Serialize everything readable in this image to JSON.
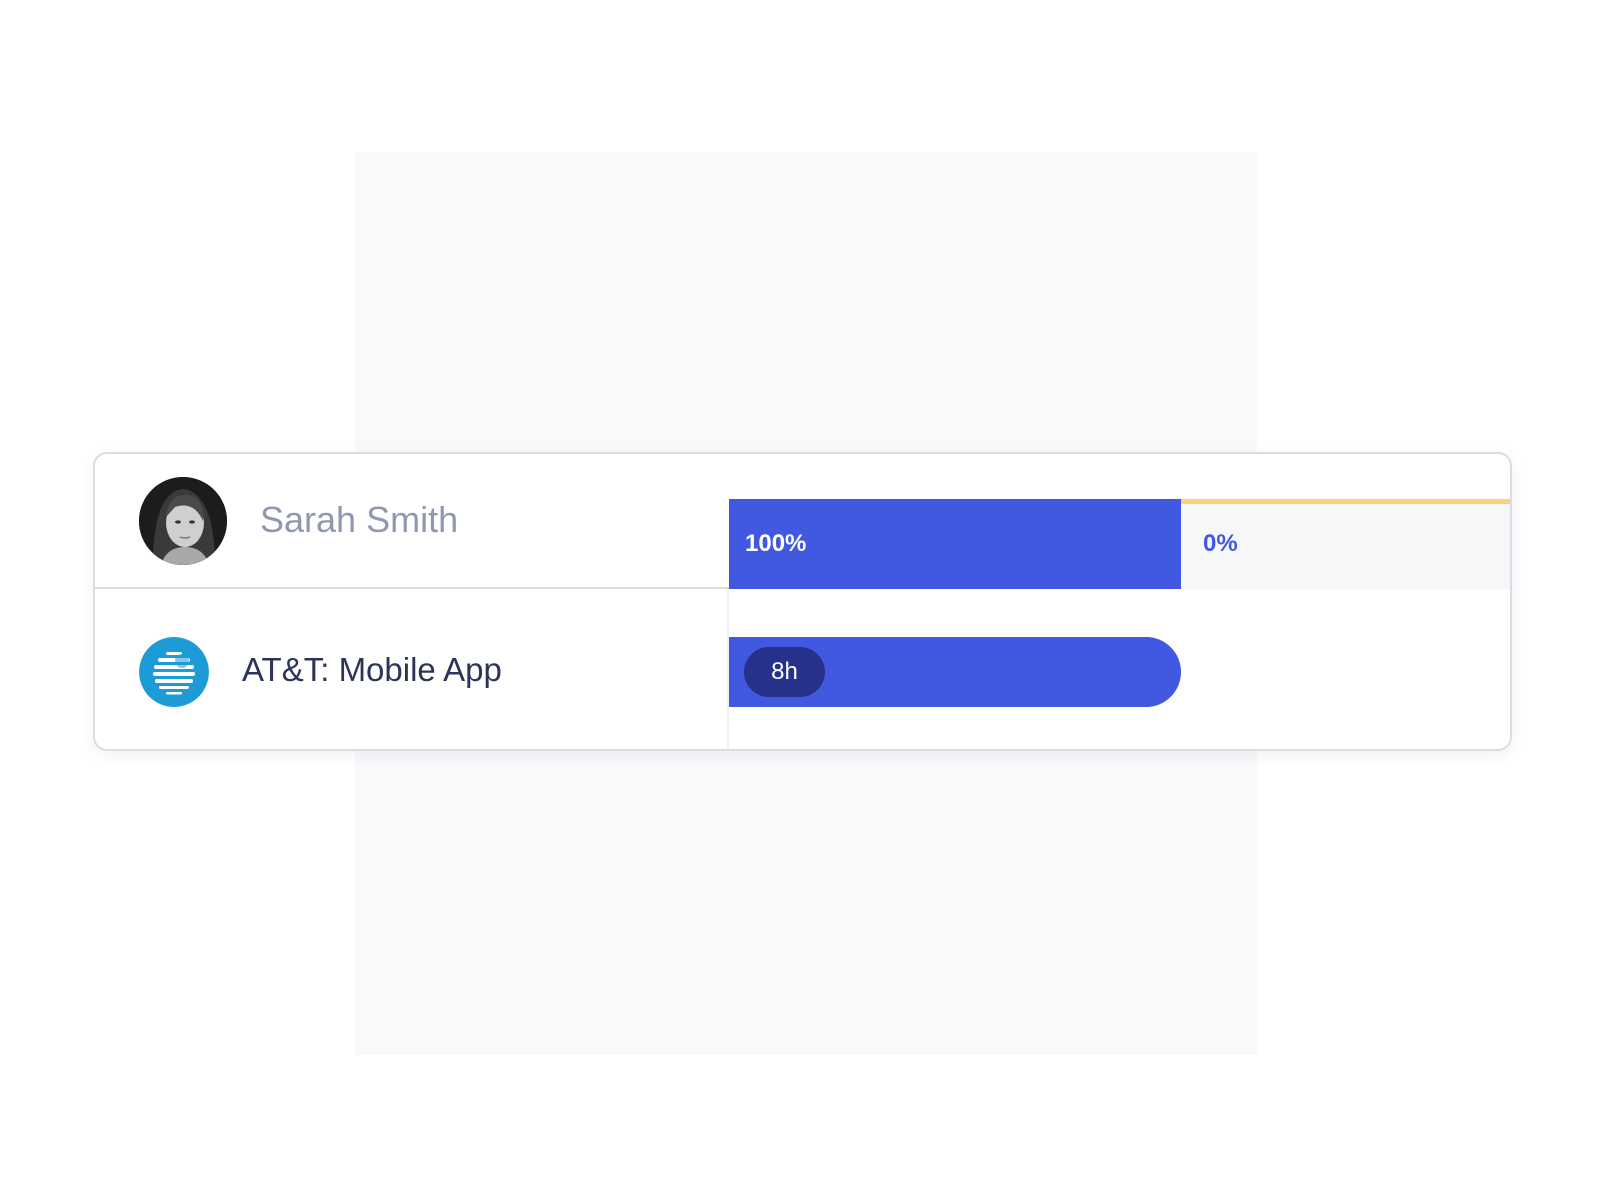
{
  "person": {
    "name": "Sarah Smith",
    "collapse_icon": "chevron-up-icon",
    "allocation": {
      "allocated_label": "100%",
      "allocated_percent": 100,
      "available_label": "0%",
      "available_percent": 0
    }
  },
  "project": {
    "logo_icon": "att-globe-icon",
    "name": "AT&T: Mobile App",
    "hours_label": "8h",
    "hours": 8
  },
  "colors": {
    "accent": "#4158e0",
    "accent_dark": "#27318a",
    "warning_line": "#f8d47c",
    "att_blue": "#1d9bd7",
    "muted_text": "#9097b1",
    "text": "#2e3455"
  }
}
